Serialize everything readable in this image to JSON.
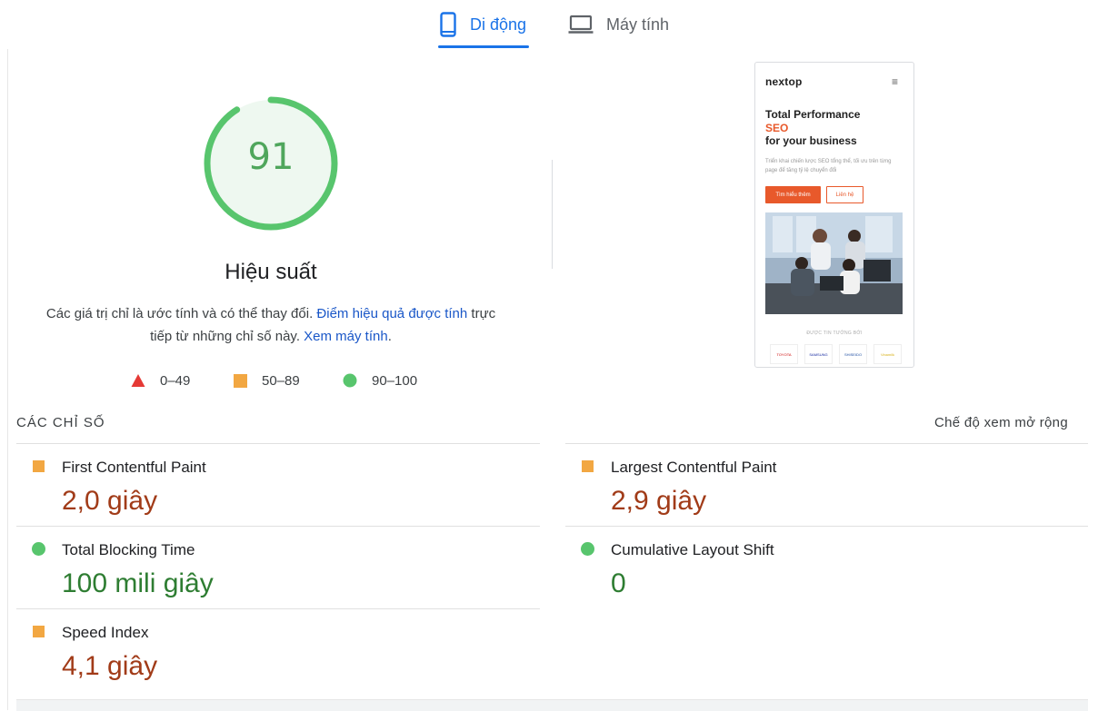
{
  "tabs": {
    "mobile": {
      "label": "Di động",
      "icon": "smartphone-icon",
      "active": true
    },
    "desktop": {
      "label": "Máy tính",
      "icon": "laptop-icon",
      "active": false
    }
  },
  "performance": {
    "score": "91",
    "score_fraction": 0.91,
    "title": "Hiệu suất",
    "desc_prefix": "Các giá trị chỉ là ước tính và có thể thay đổi. ",
    "desc_link": "Điểm hiệu quả được tính",
    "desc_mid": " trực tiếp từ những chỉ số này. ",
    "desc_link2": "Xem máy tính",
    "desc_suffix": "."
  },
  "legend": {
    "fail": "0–49",
    "average": "50–89",
    "pass": "90–100"
  },
  "colors": {
    "accent": "#1a73e8",
    "pass": "#58c56d",
    "average": "#f2a742",
    "fail": "#e53935",
    "avg_value": "#a13b18",
    "pass_value": "#2e7d32"
  },
  "preview": {
    "logo": "nextop",
    "menu_icon": "≡",
    "headline_1": "Total Performance",
    "headline_2": "SEO",
    "headline_3": "for your business",
    "subtitle": "Triển khai chiến lược SEO tổng thể, tối ưu trên từng page để tăng tỷ lệ chuyển đổi",
    "btn_primary": "Tìm hiểu thêm",
    "btn_secondary": "Liên hệ",
    "trust_label": "ĐƯỢC TIN TƯỞNG BỞI",
    "partners": [
      "TOYOTA",
      "SAMSUNG",
      "SHISEIDO",
      "Vinamilk"
    ]
  },
  "metrics": {
    "title": "CÁC CHỈ SỐ",
    "expand": "Chế độ xem mở rộng",
    "items": [
      {
        "label": "First Contentful Paint",
        "value": "2,0 giây",
        "rating": "average"
      },
      {
        "label": "Largest Contentful Paint",
        "value": "2,9 giây",
        "rating": "average"
      },
      {
        "label": "Total Blocking Time",
        "value": "100 mili giây",
        "rating": "pass"
      },
      {
        "label": "Cumulative Layout Shift",
        "value": "0",
        "rating": "pass"
      },
      {
        "label": "Speed Index",
        "value": "4,1 giây",
        "rating": "average"
      }
    ]
  }
}
